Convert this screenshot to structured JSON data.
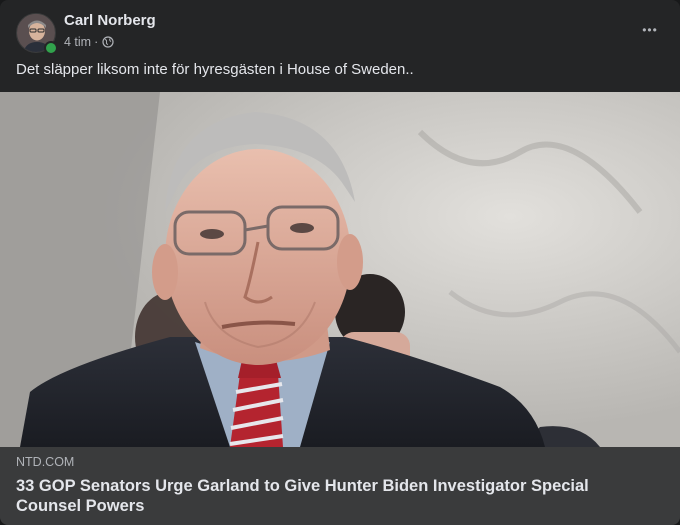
{
  "post": {
    "author": "Carl Norberg",
    "time": "4 tim",
    "separator": "·",
    "privacy_icon": "globe-icon",
    "more_label": "•••",
    "text": "Det släpper liksom inte för hyresgästen i House of Sweden.."
  },
  "link_preview": {
    "domain": "NTD.COM",
    "headline": "33 GOP Senators Urge Garland to Give Hunter Biden Investigator Special Counsel Powers"
  },
  "colors": {
    "card_bg": "#242526",
    "footer_bg": "#3a3b3c",
    "primary_text": "#e4e6eb",
    "secondary_text": "#b0b3b8",
    "online": "#31a24c"
  }
}
